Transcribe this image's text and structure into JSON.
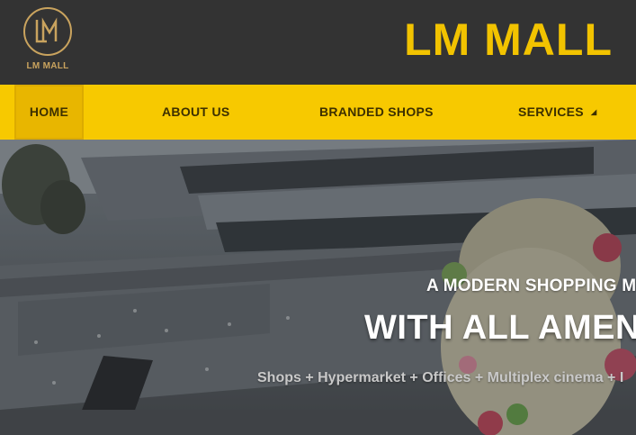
{
  "header": {
    "logo_monogram": "LM",
    "logo_text": "LM MALL",
    "site_title": "LM MALL"
  },
  "nav": {
    "items": [
      {
        "label": "HOME",
        "active": true
      },
      {
        "label": "ABOUT US",
        "active": false
      },
      {
        "label": "BRANDED SHOPS",
        "active": false
      },
      {
        "label": "SERVICES",
        "active": false,
        "has_dropdown": true
      }
    ]
  },
  "hero": {
    "tagline": "A MODERN SHOPPING M",
    "headline": "WITH ALL AMEN",
    "subline": "Shops + Hypermarket + Offices + Multiplex cinema + I"
  },
  "colors": {
    "header_bg": "#333333",
    "title_yellow": "#f2c300",
    "nav_bg": "#f7c900",
    "nav_active_bg": "#e8b600",
    "logo_gold": "#c9a35e"
  }
}
